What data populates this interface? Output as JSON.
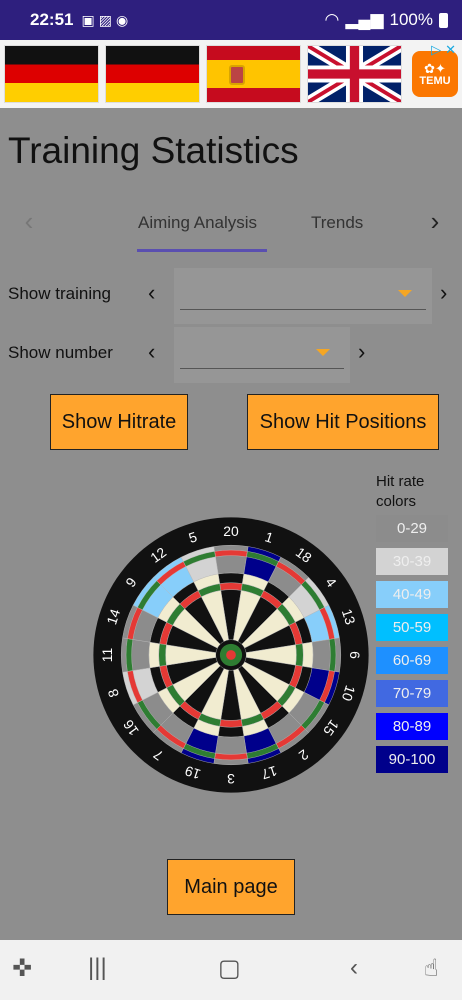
{
  "status_bar": {
    "time": "22:51",
    "battery_percent": "100%"
  },
  "ad": {
    "brand": "TEMU",
    "flags": [
      "germany",
      "germany",
      "spain",
      "united-kingdom"
    ]
  },
  "page": {
    "title": "Training Statistics"
  },
  "tabs": {
    "items": [
      "Aiming Analysis",
      "Trends"
    ],
    "active_index": 0
  },
  "filters": {
    "training_label": "Show training",
    "training_value": "",
    "number_label": "Show number",
    "number_value": ""
  },
  "buttons": {
    "hitrate": "Show Hitrate",
    "hit_positions": "Show Hit Positions",
    "main_page": "Main page"
  },
  "legend": {
    "title": "Hit rate colors",
    "items": [
      {
        "label": "0-29",
        "color": "#8c8c8c",
        "text_color": "#eeeeee"
      },
      {
        "label": "30-39",
        "color": "#d3d3d3",
        "text_color": "#eeeeee"
      },
      {
        "label": "40-49",
        "color": "#87cefa",
        "text_color": "#eeeeee"
      },
      {
        "label": "50-59",
        "color": "#00bfff",
        "text_color": "#eeeeee"
      },
      {
        "label": "60-69",
        "color": "#1e90ff",
        "text_color": "#eeeeee"
      },
      {
        "label": "70-79",
        "color": "#4169e1",
        "text_color": "#eeeeee"
      },
      {
        "label": "80-89",
        "color": "#0000ff",
        "text_color": "#eeeeee"
      },
      {
        "label": "90-100",
        "color": "#00008b",
        "text_color": "#eeeeee"
      }
    ]
  },
  "dartboard": {
    "numbers": [
      20,
      1,
      18,
      4,
      13,
      6,
      10,
      15,
      2,
      17,
      3,
      19,
      7,
      16,
      8,
      11,
      14,
      9,
      12,
      5
    ],
    "segment_colors": [
      "#8c8c8c",
      "#00008b",
      "#8c8c8c",
      "#d3d3d3",
      "#87cefa",
      "#8c8c8c",
      "#00008b",
      "#8c8c8c",
      "#8c8c8c",
      "#00008b",
      "#8c8c8c",
      "#00008b",
      "#8c8c8c",
      "#8c8c8c",
      "#d3d3d3",
      "#8c8c8c",
      "#8c8c8c",
      "#87cefa",
      "#87cefa",
      "#d3d3d3"
    ]
  },
  "colors": {
    "accent": "#ffa42d",
    "tab_indicator": "#5a4fb0",
    "status_bar": "#2e1f7e",
    "background": "#8e8e8e"
  }
}
